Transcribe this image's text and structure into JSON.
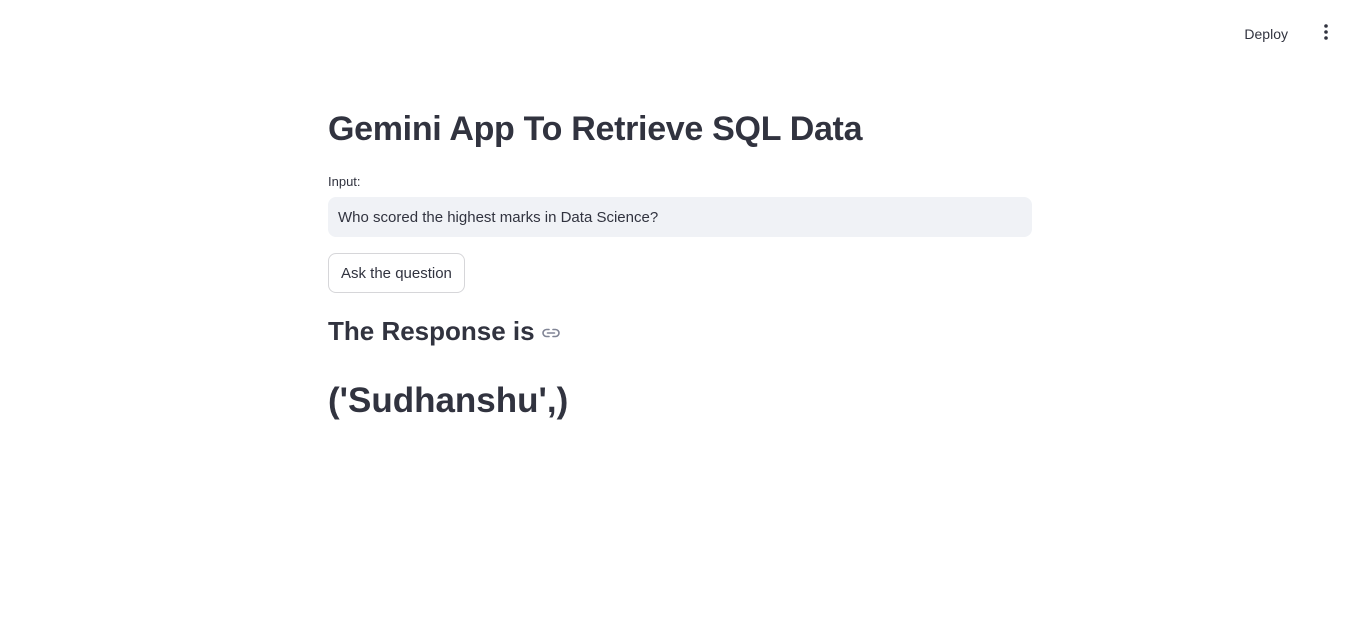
{
  "toolbar": {
    "deploy_label": "Deploy",
    "menu_icon": "more-vertical-icon"
  },
  "main": {
    "title": "Gemini App To Retrieve SQL Data",
    "input": {
      "label": "Input:",
      "value": "Who scored the highest marks in Data Science?"
    },
    "ask_button_label": "Ask the question",
    "response_heading": "The Response is",
    "response_anchor_icon": "link-icon",
    "result": "('Sudhanshu',)"
  },
  "colors": {
    "text": "#31333f",
    "input_bg": "#f0f2f6",
    "background": "#ffffff"
  }
}
